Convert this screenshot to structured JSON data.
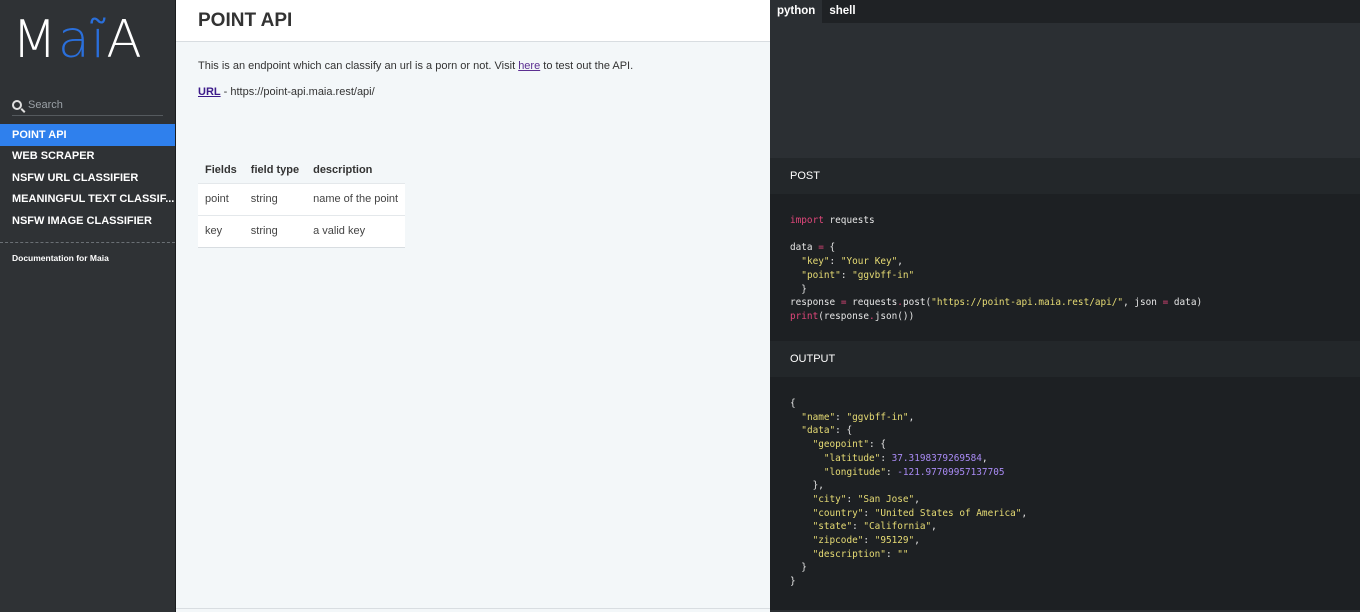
{
  "sidebar": {
    "logo": [
      "M",
      "a",
      "ĩ",
      "A"
    ],
    "search_placeholder": "Search",
    "items": [
      {
        "label": "POINT API",
        "active": true
      },
      {
        "label": "WEB SCRAPER",
        "active": false
      },
      {
        "label": "NSFW URL CLASSIFIER",
        "active": false
      },
      {
        "label": "MEANINGFUL TEXT CLASSIF...",
        "active": false
      },
      {
        "label": "NSFW IMAGE CLASSIFIER",
        "active": false
      }
    ],
    "doc_link": "Documentation for Maia"
  },
  "content": {
    "title": "POINT API",
    "intro_before": "This is an endpoint which can classify an url is a porn or not. Visit ",
    "intro_link": "here",
    "intro_after": " to test out the API.",
    "url_label": "URL",
    "url_text": " - https://point-api.maia.rest/api/",
    "table": {
      "headers": [
        "Fields",
        "field type",
        "description"
      ],
      "rows": [
        [
          "point",
          "string",
          "name of the point"
        ],
        [
          "key",
          "string",
          "a valid key"
        ]
      ]
    }
  },
  "code_panel": {
    "tabs": [
      {
        "label": "python",
        "active": true
      },
      {
        "label": "shell",
        "active": false
      }
    ],
    "post_label": "POST",
    "output_label": "OUTPUT",
    "post_lines": [
      [
        [
          "kw",
          "import"
        ],
        [
          "t",
          " requests"
        ]
      ],
      [],
      [
        [
          "t",
          "data "
        ],
        [
          "op",
          "="
        ],
        [
          "t",
          " {"
        ]
      ],
      [
        [
          "t",
          "  "
        ],
        [
          "str",
          "\"key\""
        ],
        [
          "t",
          ": "
        ],
        [
          "str",
          "\"Your Key\""
        ],
        [
          "t",
          ","
        ]
      ],
      [
        [
          "t",
          "  "
        ],
        [
          "str",
          "\"point\""
        ],
        [
          "t",
          ": "
        ],
        [
          "str",
          "\"ggvbff-in\""
        ]
      ],
      [
        [
          "t",
          "  }"
        ]
      ],
      [
        [
          "t",
          "response "
        ],
        [
          "op",
          "="
        ],
        [
          "t",
          " requests"
        ],
        [
          "op",
          "."
        ],
        [
          "t",
          "post("
        ],
        [
          "str",
          "\"https://point-api.maia.rest/api/\""
        ],
        [
          "t",
          ", json "
        ],
        [
          "op",
          "="
        ],
        [
          "t",
          " data)"
        ]
      ],
      [
        [
          "kw",
          "print"
        ],
        [
          "t",
          "(response"
        ],
        [
          "op",
          "."
        ],
        [
          "t",
          "json())"
        ]
      ]
    ],
    "output_lines": [
      [
        [
          "t",
          "{"
        ]
      ],
      [
        [
          "t",
          "  "
        ],
        [
          "str",
          "\"name\""
        ],
        [
          "t",
          ": "
        ],
        [
          "str",
          "\"ggvbff-in\""
        ],
        [
          "t",
          ","
        ]
      ],
      [
        [
          "t",
          "  "
        ],
        [
          "str",
          "\"data\""
        ],
        [
          "t",
          ": {"
        ]
      ],
      [
        [
          "t",
          "    "
        ],
        [
          "str",
          "\"geopoint\""
        ],
        [
          "t",
          ": {"
        ]
      ],
      [
        [
          "t",
          "      "
        ],
        [
          "str",
          "\"latitude\""
        ],
        [
          "t",
          ": "
        ],
        [
          "num",
          "37.3198379269584"
        ],
        [
          "t",
          ","
        ]
      ],
      [
        [
          "t",
          "      "
        ],
        [
          "str",
          "\"longitude\""
        ],
        [
          "t",
          ": "
        ],
        [
          "num",
          "-121.97709957137705"
        ]
      ],
      [
        [
          "t",
          "    },"
        ]
      ],
      [
        [
          "t",
          "    "
        ],
        [
          "str",
          "\"city\""
        ],
        [
          "t",
          ": "
        ],
        [
          "str",
          "\"San Jose\""
        ],
        [
          "t",
          ","
        ]
      ],
      [
        [
          "t",
          "    "
        ],
        [
          "str",
          "\"country\""
        ],
        [
          "t",
          ": "
        ],
        [
          "str",
          "\"United States of America\""
        ],
        [
          "t",
          ","
        ]
      ],
      [
        [
          "t",
          "    "
        ],
        [
          "str",
          "\"state\""
        ],
        [
          "t",
          ": "
        ],
        [
          "str",
          "\"California\""
        ],
        [
          "t",
          ","
        ]
      ],
      [
        [
          "t",
          "    "
        ],
        [
          "str",
          "\"zipcode\""
        ],
        [
          "t",
          ": "
        ],
        [
          "str",
          "\"95129\""
        ],
        [
          "t",
          ","
        ]
      ],
      [
        [
          "t",
          "    "
        ],
        [
          "str",
          "\"description\""
        ],
        [
          "t",
          ": "
        ],
        [
          "str",
          "\"\""
        ]
      ],
      [
        [
          "t",
          "  }"
        ]
      ],
      [
        [
          "t",
          "}"
        ]
      ]
    ]
  },
  "colors": {
    "accent": "#2f80ed",
    "logo_blue": "#2a6fdb",
    "sidebar_bg": "#2f3235",
    "code_keyword": "#e0467a",
    "code_string": "#e6db74",
    "code_number": "#a98bf5"
  },
  "icons": {
    "search": "search-icon"
  }
}
